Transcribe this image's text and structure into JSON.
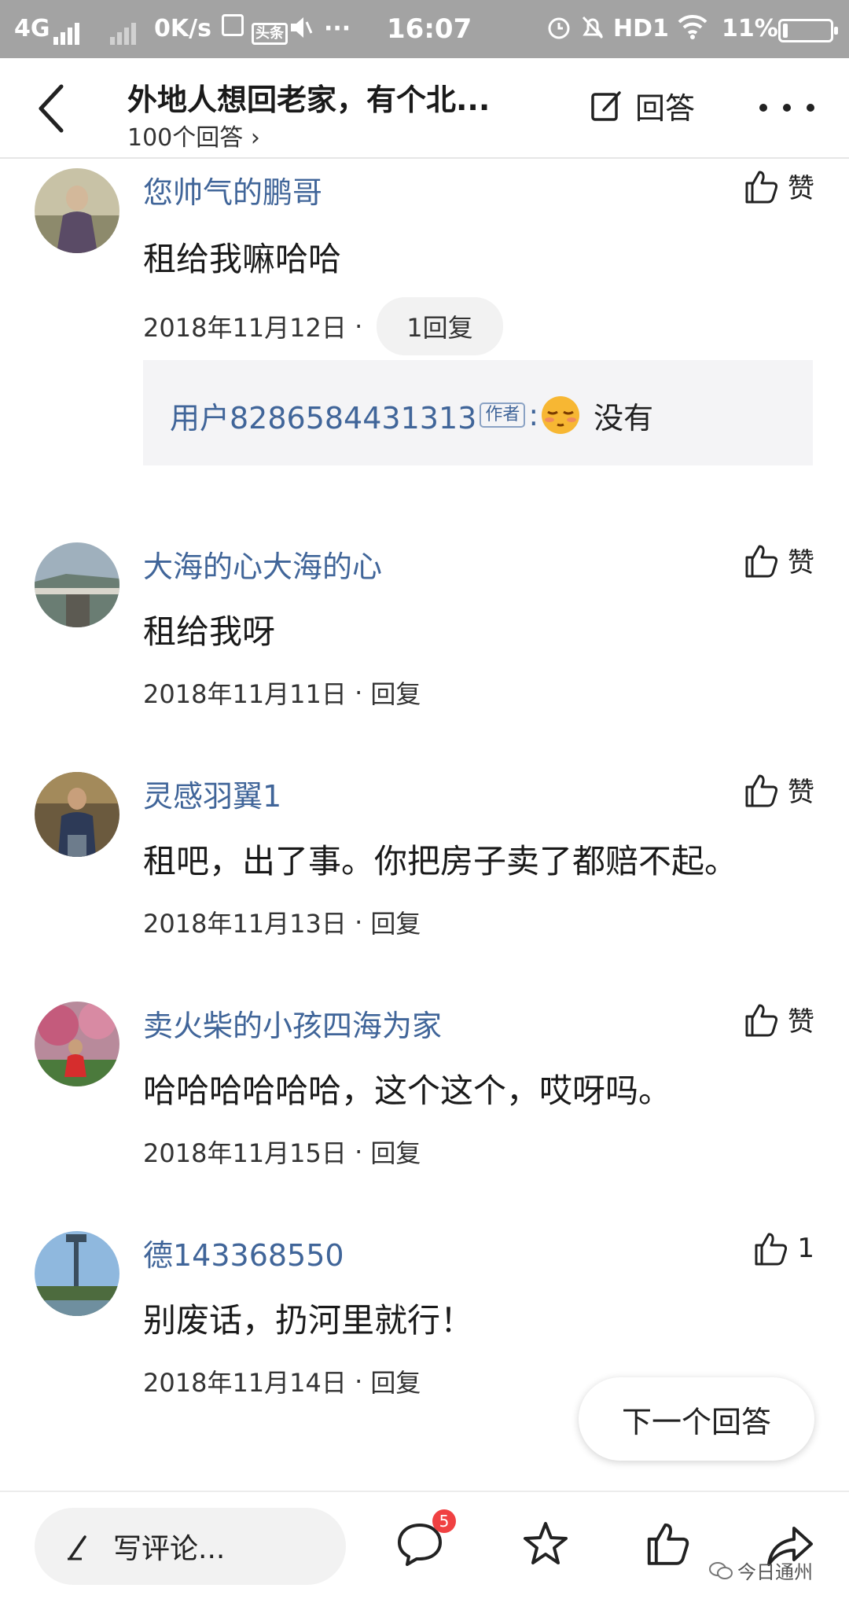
{
  "status_bar": {
    "network": "4G",
    "speed": "0K/s",
    "app_badge": "头条",
    "more": "···",
    "time": "16:07",
    "hd": "HD1",
    "battery": "11%",
    "battery_level": 0.11
  },
  "header": {
    "title": "外地人想回老家，有个北...",
    "answer_count": "100个回答",
    "answer_label": "回答"
  },
  "comments": [
    {
      "username": "您帅气的鹏哥",
      "text": "租给我嘛哈哈",
      "date": "2018年11月12日",
      "reply_label": "1回复",
      "like_label": "赞",
      "replies": [
        {
          "username": "用户8286584431313",
          "tag": "作者",
          "text": "没有"
        }
      ]
    },
    {
      "username": "大海的心大海的心",
      "text": "租给我呀",
      "date": "2018年11月11日",
      "reply_label": "回复",
      "like_label": "赞"
    },
    {
      "username": "灵感羽翼1",
      "text": "租吧，出了事。你把房子卖了都赔不起。",
      "date": "2018年11月13日",
      "reply_label": "回复",
      "like_label": "赞"
    },
    {
      "username": "卖火柴的小孩四海为家",
      "text": "哈哈哈哈哈哈，这个这个，哎呀吗。",
      "date": "2018年11月15日",
      "reply_label": "回复",
      "like_label": "赞"
    },
    {
      "username": "德143368550",
      "text": "别废话，扔河里就行！",
      "date": "2018年11月14日",
      "reply_label": "回复",
      "like_label": "1"
    }
  ],
  "next_answer": "下一个回答",
  "bottom_bar": {
    "write_placeholder": "写评论...",
    "comment_badge": "5",
    "watermark": "今日通州"
  },
  "icons": [
    "back-arrow-icon",
    "edit-icon",
    "more-dots-icon",
    "thumbs-up-icon",
    "pen-icon",
    "comment-bubble-icon",
    "star-icon",
    "share-icon"
  ],
  "colors": {
    "username": "#406599",
    "badge": "#f04142",
    "status_bar": "#a3a3a3"
  }
}
